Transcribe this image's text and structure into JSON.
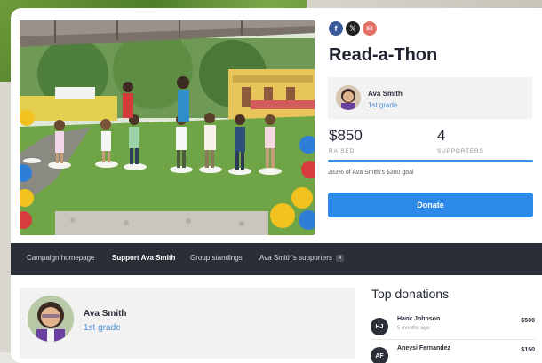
{
  "share": {
    "icons": [
      "facebook-icon",
      "x-icon",
      "email-icon"
    ],
    "facebook_glyph": "f",
    "x_glyph": "𝕏",
    "email_glyph": "✉"
  },
  "campaign": {
    "title": "Read-a-Thon"
  },
  "owner": {
    "name": "Ava Smith",
    "grade": "1st grade"
  },
  "stats": {
    "raised_amount": "$850",
    "raised_label": "RAISED",
    "supporters_count": "4",
    "supporters_label": "SUPPORTERS",
    "progress_percent": 100,
    "goal_text": "283% of Ava Smith's $300 goal"
  },
  "donate": {
    "label": "Donate"
  },
  "nav": {
    "items": [
      {
        "label": "Campaign homepage"
      },
      {
        "label": "Support Ava Smith"
      },
      {
        "label": "Group standings"
      },
      {
        "label": "Ava Smith's supporters",
        "badge": "4"
      }
    ]
  },
  "top_donations": {
    "title": "Top donations",
    "items": [
      {
        "initials": "HJ",
        "name": "Hank Johnson",
        "time": "5 months ago",
        "amount": "$500"
      },
      {
        "initials": "AF",
        "name": "Aneysi Fernandez",
        "time": "",
        "amount": "$150"
      }
    ]
  },
  "colors": {
    "accent": "#2d8ae8",
    "nav_bg": "#2a2e37",
    "link": "#4a90d9"
  }
}
